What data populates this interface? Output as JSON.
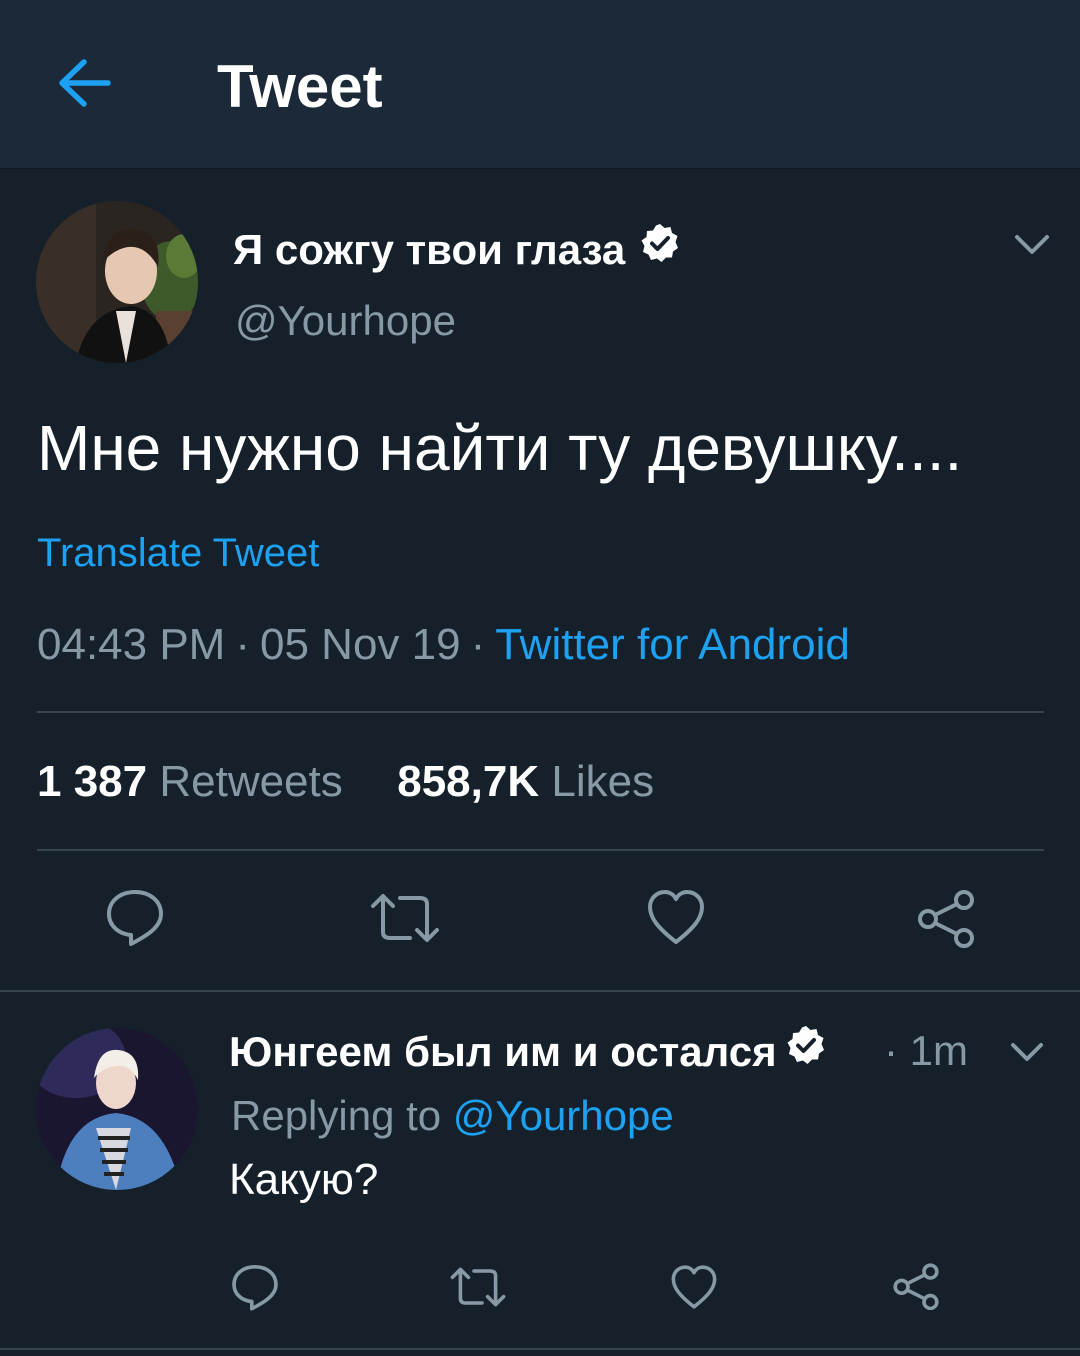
{
  "header": {
    "title": "Tweet"
  },
  "tweet": {
    "author_name": "Я сожгу твои глаза",
    "author_handle": "@Yourhope",
    "text": "Мне нужно найти ту девушку....",
    "translate_label": "Translate Tweet",
    "time": "04:43 PM",
    "date": "05 Nov 19",
    "separator": "·",
    "client": "Twitter for Android",
    "retweets_count": "1 387",
    "retweets_label": "Retweets",
    "likes_count": "858,7K",
    "likes_label": "Likes"
  },
  "reply": {
    "author_name": "Юнгеем был им и остался",
    "time": "· 1m",
    "replying_to_label": "Replying to",
    "replying_to_handle": "@Yourhope",
    "text": "Какую?"
  },
  "colors": {
    "background": "#15202b",
    "header": "#1c2938",
    "accent": "#1da1f2",
    "secondary_text": "#8899a6",
    "divider": "#38444d"
  },
  "icons": [
    "back-arrow-icon",
    "verified-badge-icon",
    "chevron-down-icon",
    "reply-icon",
    "retweet-icon",
    "like-icon",
    "share-icon"
  ]
}
